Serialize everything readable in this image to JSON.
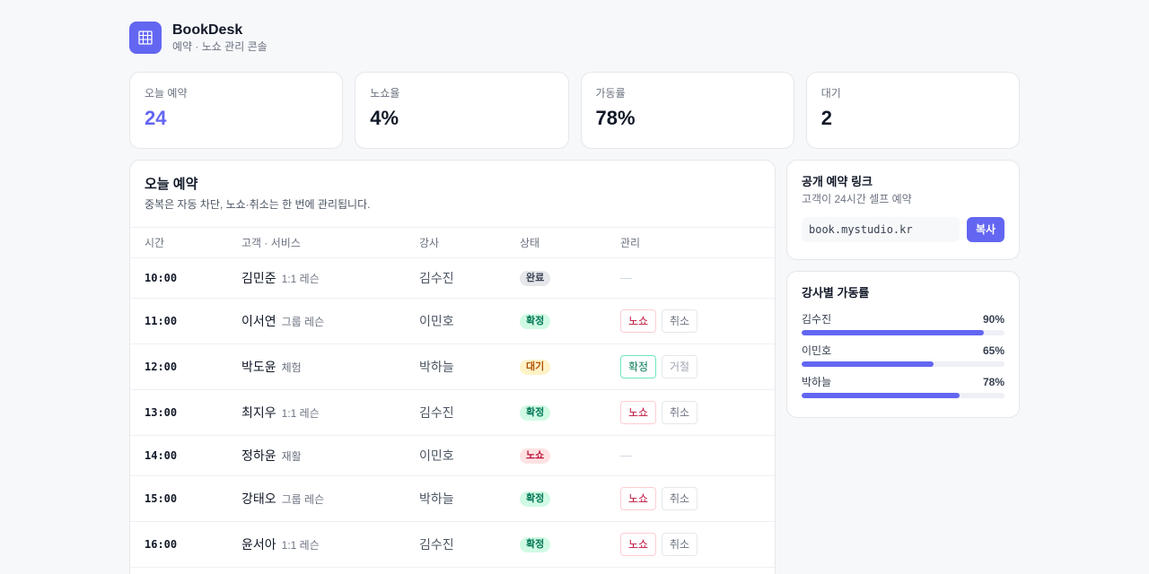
{
  "brand": {
    "title": "BookDesk",
    "subtitle": "예약 · 노쇼 관리 콘솔",
    "logo_icon": "calendar-grid-icon"
  },
  "stats": [
    {
      "label": "오늘 예약",
      "value": "24",
      "accent": true
    },
    {
      "label": "노쇼율",
      "value": "4%",
      "accent": false
    },
    {
      "label": "가동률",
      "value": "78%",
      "accent": false
    },
    {
      "label": "대기",
      "value": "2",
      "accent": false
    }
  ],
  "bookings": {
    "title": "오늘 예약",
    "subtitle": "중복은 자동 차단, 노쇼·취소는 한 번에 관리됩니다.",
    "columns": [
      "시간",
      "고객 · 서비스",
      "강사",
      "상태",
      "관리"
    ],
    "rows": [
      {
        "time": "10:00",
        "customer": "김민준",
        "service": "1:1 레슨",
        "instructor": "김수진",
        "status": "완료",
        "actions": [
          "—"
        ]
      },
      {
        "time": "11:00",
        "customer": "이서연",
        "service": "그룹 레슨",
        "instructor": "이민호",
        "status": "확정",
        "actions": [
          "노쇼",
          "취소"
        ]
      },
      {
        "time": "12:00",
        "customer": "박도윤",
        "service": "체험",
        "instructor": "박하늘",
        "status": "대기",
        "actions": [
          "확정",
          "거절"
        ]
      },
      {
        "time": "13:00",
        "customer": "최지우",
        "service": "1:1 레슨",
        "instructor": "김수진",
        "status": "확정",
        "actions": [
          "노쇼",
          "취소"
        ]
      },
      {
        "time": "14:00",
        "customer": "정하윤",
        "service": "재활",
        "instructor": "이민호",
        "status": "노쇼",
        "actions": [
          "—"
        ]
      },
      {
        "time": "15:00",
        "customer": "강태오",
        "service": "그룹 레슨",
        "instructor": "박하늘",
        "status": "확정",
        "actions": [
          "노쇼",
          "취소"
        ]
      },
      {
        "time": "16:00",
        "customer": "윤서아",
        "service": "1:1 레슨",
        "instructor": "김수진",
        "status": "확정",
        "actions": [
          "노쇼",
          "취소"
        ]
      }
    ]
  },
  "public_link": {
    "title": "공개 예약 링크",
    "subtitle": "고객이 24시간 셀프 예약",
    "url": "book.mystudio.kr",
    "copy_label": "복사"
  },
  "utilization": {
    "title": "강사별 가동률",
    "items": [
      {
        "name": "김수진",
        "pct_label": "90%",
        "value": 0.9
      },
      {
        "name": "이민호",
        "pct_label": "65%",
        "value": 0.65
      },
      {
        "name": "박하늘",
        "pct_label": "78%",
        "value": 0.78
      }
    ]
  },
  "colors": {
    "accent": "#6366f1",
    "confirmed": "#047857",
    "waiting": "#b45309",
    "noshow": "#be123c",
    "done": "#374151"
  }
}
